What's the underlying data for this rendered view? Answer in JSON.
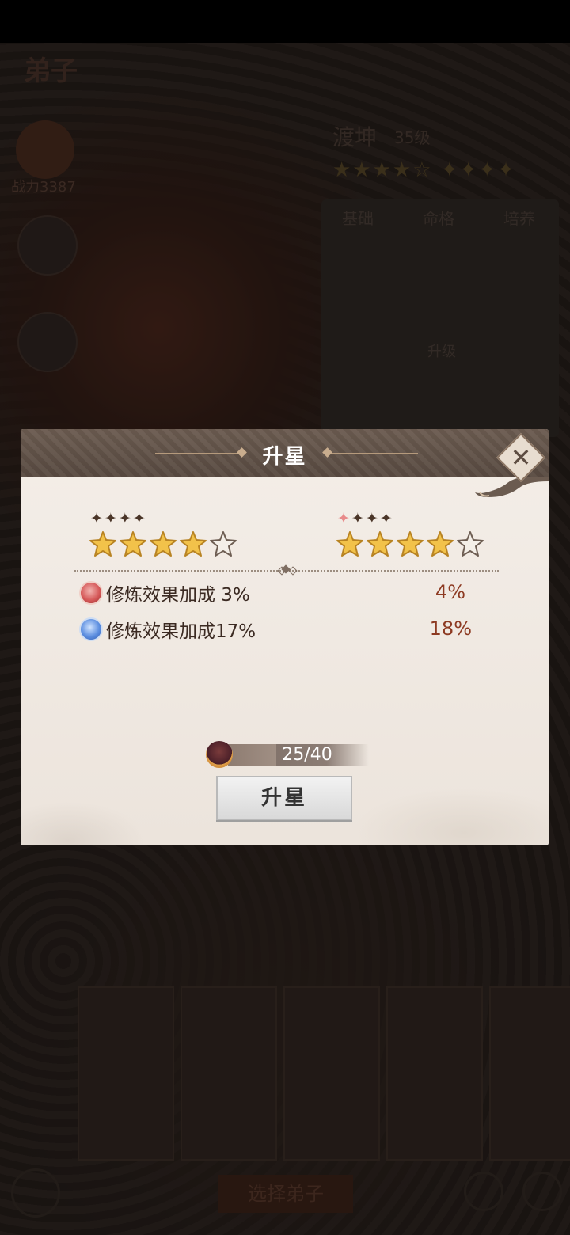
{
  "background": {
    "title": "弟子",
    "power": "战力3387",
    "disciple_name": "渡坤",
    "disciple_level": "35级",
    "tabs": [
      "基础",
      "命格",
      "培养"
    ],
    "upgrade_label": "升级",
    "select_button": "选择弟子"
  },
  "dialog": {
    "title": "升星",
    "current": {
      "small_stars": 4,
      "big_stars_filled": 4,
      "big_stars_total": 5
    },
    "next": {
      "small_stars": 4,
      "highlight_first": true,
      "big_stars_filled": 4,
      "big_stars_total": 5
    },
    "stats": [
      {
        "icon": "red-orb-icon",
        "label": "修炼效果加成 3%",
        "new_value": "4%"
      },
      {
        "icon": "blue-orb-icon",
        "label": "修炼效果加成17%",
        "new_value": "18%"
      }
    ],
    "progress": {
      "current": 25,
      "total": 40,
      "text": "25/40"
    },
    "upgrade_button": "升星",
    "close_icon": "close-icon"
  },
  "colors": {
    "header": "#5f5046",
    "panel": "#f0e9e2",
    "star": "#f2c24a",
    "stat_value": "#8d3a22"
  }
}
